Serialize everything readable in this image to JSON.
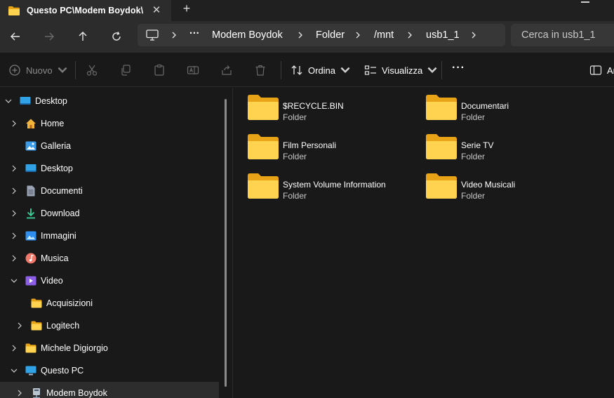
{
  "tab": {
    "title": "Questo PC\\Modem Boydok\\",
    "close_glyph": "✕",
    "new_glyph": "+"
  },
  "address": {
    "overflow": "···",
    "segments": [
      "Modem Boydok",
      "Folder",
      "/mnt",
      "usb1_1"
    ]
  },
  "search": {
    "placeholder": "Cerca in usb1_1"
  },
  "toolbar": {
    "new_label": "Nuovo",
    "sort_label": "Ordina",
    "view_label": "Visualizza",
    "more_glyph": "···",
    "details_label": "Ar"
  },
  "sidebar": {
    "items": [
      {
        "label": "Desktop",
        "icon": "desktop-icon"
      },
      {
        "label": "Home",
        "icon": "home-icon"
      },
      {
        "label": "Galleria",
        "icon": "gallery-icon"
      },
      {
        "label": "Desktop",
        "icon": "desktop-icon"
      },
      {
        "label": "Documenti",
        "icon": "documents-icon"
      },
      {
        "label": "Download",
        "icon": "download-icon"
      },
      {
        "label": "Immagini",
        "icon": "pictures-icon"
      },
      {
        "label": "Musica",
        "icon": "music-icon"
      },
      {
        "label": "Video",
        "icon": "video-icon"
      },
      {
        "label": "Acquisizioni",
        "icon": "folder-icon"
      },
      {
        "label": "Logitech",
        "icon": "folder-icon"
      },
      {
        "label": "Michele Digiorgio",
        "icon": "folder-icon"
      },
      {
        "label": "Questo PC",
        "icon": "this-pc-icon"
      },
      {
        "label": "Modem Boydok",
        "icon": "network-drive-icon"
      }
    ]
  },
  "files": [
    {
      "name": "$RECYCLE.BIN",
      "type": "Folder"
    },
    {
      "name": "Documentari",
      "type": "Folder"
    },
    {
      "name": "Film Personali",
      "type": "Folder"
    },
    {
      "name": "Serie TV",
      "type": "Folder"
    },
    {
      "name": "System Volume Information",
      "type": "Folder"
    },
    {
      "name": "Video Musicali",
      "type": "Folder"
    }
  ],
  "colors": {
    "folder_front": "#ffd34f",
    "folder_back": "#e8a317",
    "accent": "#4cc2ff"
  }
}
